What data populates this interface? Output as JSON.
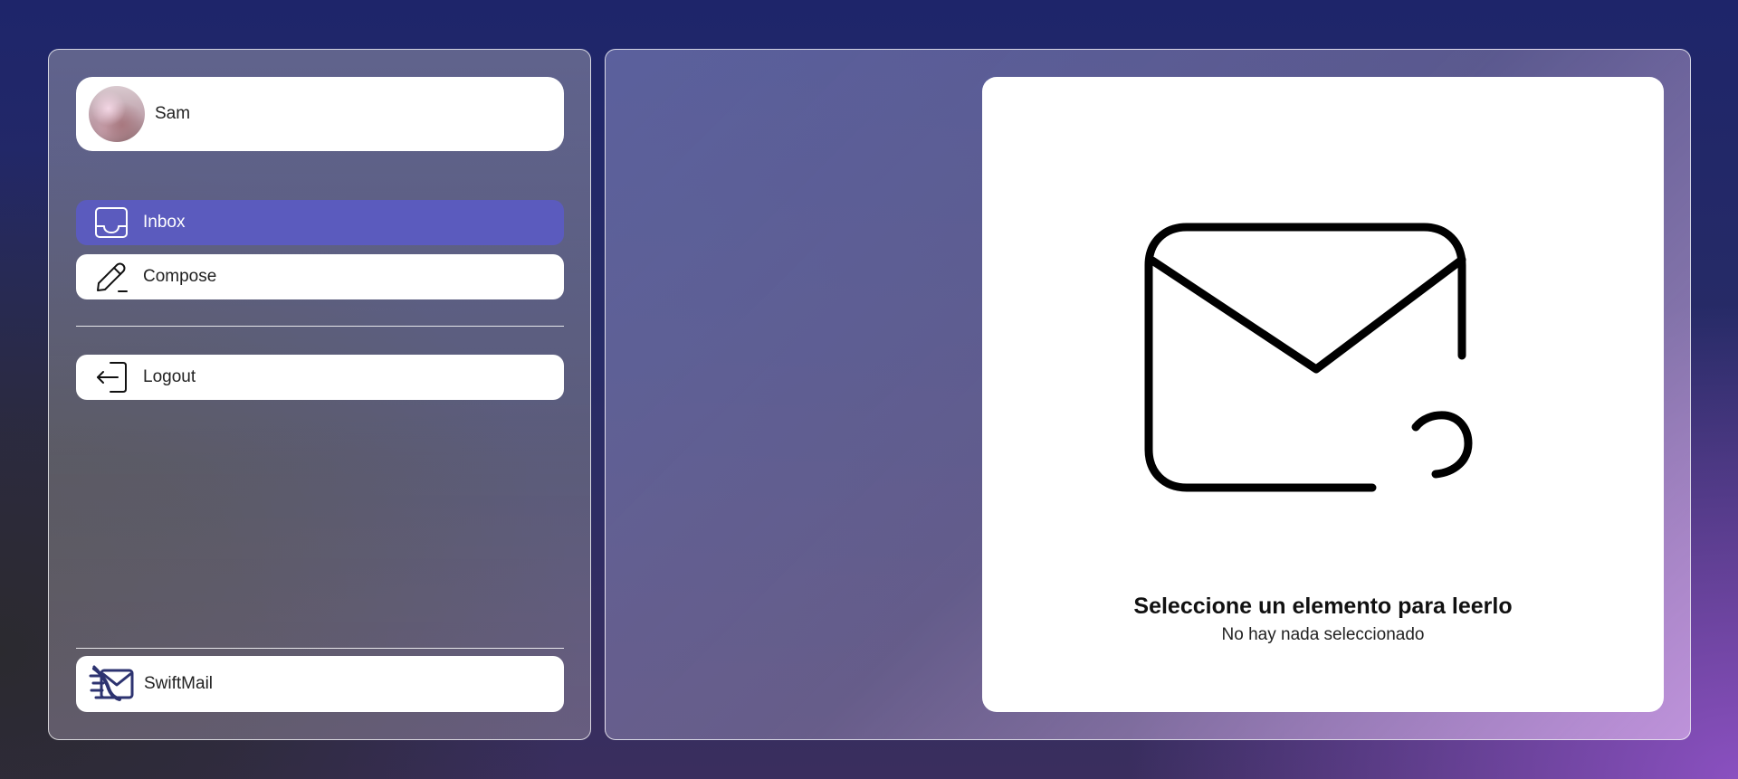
{
  "user": {
    "name": "Sam"
  },
  "nav": {
    "items": [
      {
        "label": "Inbox",
        "icon": "inbox-icon",
        "active": true
      },
      {
        "label": "Compose",
        "icon": "pencil-icon",
        "active": false
      }
    ],
    "logout": {
      "label": "Logout",
      "icon": "logout-icon"
    }
  },
  "brand": {
    "name": "SwiftMail",
    "icon": "swiftmail-logo-icon"
  },
  "reading_pane": {
    "title": "Seleccione un elemento para leerlo",
    "subtitle": "No hay nada seleccionado",
    "icon": "mail-question-icon"
  },
  "colors": {
    "accent": "#5b5bbe",
    "card": "#ffffff",
    "brand_logo": "#2d3370"
  }
}
